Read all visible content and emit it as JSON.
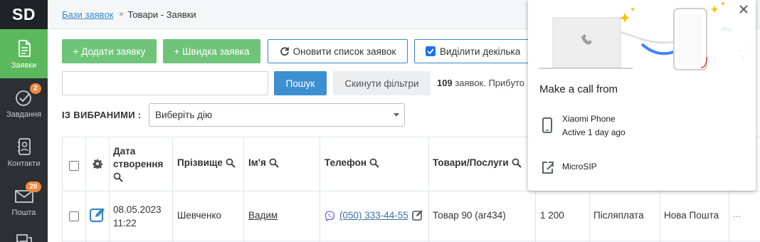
{
  "app": {
    "logo": "SD"
  },
  "sidebar": {
    "items": [
      {
        "label": "Заявки",
        "icon": "document-icon",
        "active": true,
        "badge": ""
      },
      {
        "label": "Завдання",
        "icon": "check-circle-icon",
        "active": false,
        "badge": "2"
      },
      {
        "label": "Контакти",
        "icon": "contacts-icon",
        "active": false,
        "badge": ""
      },
      {
        "label": "Пошта",
        "icon": "mail-icon",
        "active": false,
        "badge": "20"
      }
    ]
  },
  "breadcrumb": {
    "parent": "Бази заявок",
    "separator": "»",
    "current": "Товари - Заявки"
  },
  "toolbar": {
    "add_label": "+ Додати заявку",
    "quick_label": "+ Швидка заявка",
    "refresh_label": "Оновити список заявок",
    "multi_select_label": "Виділити декілька"
  },
  "search": {
    "value": "",
    "button": "Пошук",
    "reset": "Скинути фільтри"
  },
  "summary": {
    "count": "109",
    "text": "заявок. Прибуто"
  },
  "bulk": {
    "label": "ІЗ ВИБРАНИМИ :",
    "selected": "Виберіть дію"
  },
  "table": {
    "headers": {
      "date": "Дата створення",
      "surname": "Прізвище",
      "name": "Ім'я",
      "phone": "Телефон",
      "goods": "Товари/Послуги"
    },
    "rows": [
      {
        "date": "08.05.2023",
        "time": "11:22",
        "surname": "Шевченко",
        "name": "Вадим",
        "phone": "(050) 333-44-55",
        "goods": "Товар 90 (ar434)",
        "amount": "1 200",
        "payment": "Післяплата",
        "delivery": "Нова Пошта",
        "more": "..."
      }
    ]
  },
  "call_popup": {
    "title": "Make a call from",
    "options": [
      {
        "name": "Xiaomi Phone",
        "sub": "Active 1 day ago",
        "icon": "smartphone-icon"
      },
      {
        "name": "MicroSIP",
        "sub": "",
        "icon": "open-external-icon"
      }
    ]
  },
  "colors": {
    "accent_green": "#5cb85c",
    "accent_blue": "#3d8fd0",
    "sidebar_bg": "#2c3035",
    "badge": "#f0883e"
  }
}
